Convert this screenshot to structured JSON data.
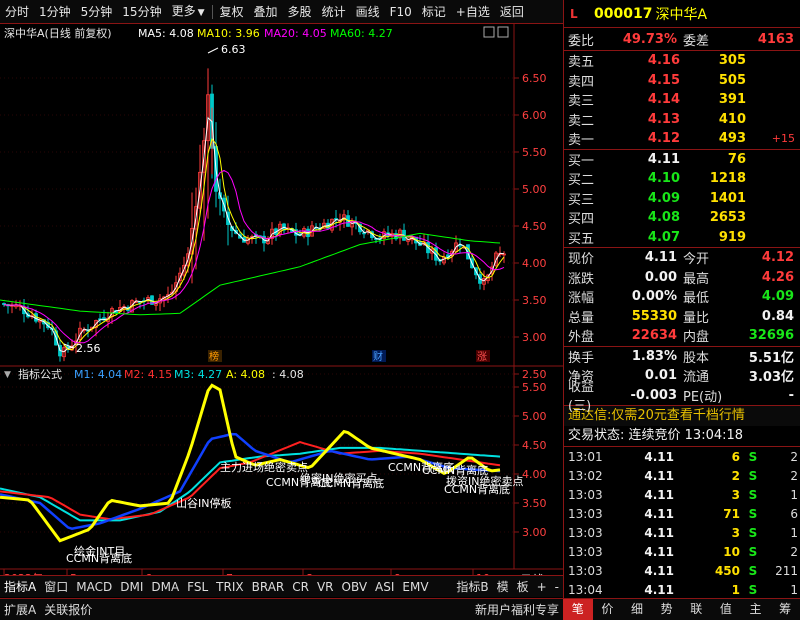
{
  "toolbar": {
    "items": [
      "分时",
      "1分钟",
      "5分钟",
      "15分钟",
      "更多",
      "复权",
      "叠加",
      "多股",
      "统计",
      "画线",
      "F10",
      "标记",
      "+自选",
      "返回"
    ]
  },
  "main_chart": {
    "title": "深中华A(日线 前复权)",
    "ma5": "MA5: 4.08",
    "ma10": "MA10: 3.96",
    "ma20": "MA20: 4.05",
    "ma60": "MA60: 4.27",
    "high_label": "6.63",
    "low_label": "2.56",
    "y_ticks": [
      "6.50",
      "6.00",
      "5.50",
      "5.00",
      "4.50",
      "4.00",
      "3.50",
      "3.00",
      "2.50"
    ],
    "markers": [
      "榜",
      "财",
      "涨"
    ]
  },
  "sub_chart": {
    "title": "指标公式",
    "m1": "M1: 4.04",
    "m2": "M2: 4.15",
    "m3": "M3: 4.27",
    "a": "A: 4.08",
    "extra": ": 4.08",
    "y_ticks": [
      "5.50",
      "5.00",
      "4.50",
      "4.00",
      "3.50",
      "3.00"
    ],
    "annotations": [
      "CCMN背离底",
      "绘金INT目",
      "山谷IN停板",
      "CCMN背离底",
      "主力进场绝密卖点",
      "CCMN背离底",
      "绝密IN绝密买点",
      "CCMN背离底",
      "CCMN背离底",
      "拨资IN绝密卖点",
      "CCMN背离底"
    ]
  },
  "x_axis": {
    "labels": [
      "2022年",
      "5",
      "6",
      "7",
      "8",
      "9",
      "10"
    ],
    "unit": "日线"
  },
  "bottom": {
    "row1": [
      "指标A",
      "窗口",
      "MACD",
      "DMI",
      "DMA",
      "FSL",
      "TRIX",
      "BRAR",
      "CR",
      "VR",
      "OBV",
      "ASI",
      "EMV",
      "指标B",
      "模",
      "板",
      "+",
      "-"
    ],
    "row2": [
      "扩展A",
      "关联报价"
    ],
    "promo": "新用户福利专享",
    "tabs": [
      "笔",
      "价",
      "细",
      "势",
      "联",
      "值",
      "主",
      "筹"
    ]
  },
  "quote": {
    "flag": "L",
    "code": "000017",
    "name": "深中华A",
    "weibi_label": "委比",
    "weibi": "49.73%",
    "weicha_label": "委差",
    "weicha": "4163",
    "asks": [
      {
        "label": "卖五",
        "price": "4.16",
        "vol": "305",
        "chg": ""
      },
      {
        "label": "卖四",
        "price": "4.15",
        "vol": "505",
        "chg": ""
      },
      {
        "label": "卖三",
        "price": "4.14",
        "vol": "391",
        "chg": ""
      },
      {
        "label": "卖二",
        "price": "4.13",
        "vol": "410",
        "chg": ""
      },
      {
        "label": "卖一",
        "price": "4.12",
        "vol": "493",
        "chg": "+15"
      }
    ],
    "bids": [
      {
        "label": "买一",
        "price": "4.11",
        "vol": "76",
        "chg": ""
      },
      {
        "label": "买二",
        "price": "4.10",
        "vol": "1218",
        "chg": ""
      },
      {
        "label": "买三",
        "price": "4.09",
        "vol": "1401",
        "chg": ""
      },
      {
        "label": "买四",
        "price": "4.08",
        "vol": "2653",
        "chg": ""
      },
      {
        "label": "买五",
        "price": "4.07",
        "vol": "919",
        "chg": ""
      }
    ],
    "stats": [
      {
        "a": "现价",
        "b": "4.11",
        "c": "今开",
        "d": "4.12"
      },
      {
        "a": "涨跌",
        "b": "0.00",
        "c": "最高",
        "d": "4.26"
      },
      {
        "a": "涨幅",
        "b": "0.00%",
        "c": "最低",
        "d": "4.09"
      },
      {
        "a": "总量",
        "b": "55330",
        "c": "量比",
        "d": "0.84"
      },
      {
        "a": "外盘",
        "b": "22634",
        "c": "内盘",
        "d": "32696"
      }
    ],
    "stats2": [
      {
        "a": "换手",
        "b": "1.83%",
        "c": "股本",
        "d": "5.51亿"
      },
      {
        "a": "净资",
        "b": "0.01",
        "c": "流通",
        "d": "3.03亿"
      },
      {
        "a": "收益(三)",
        "b": "-0.003",
        "c": "PE(动)",
        "d": "-"
      }
    ],
    "promo": "通达信:仅需20元查看千档行情",
    "status_label": "交易状态: 连续竞价",
    "status_time": "13:04:18",
    "trades": [
      {
        "t": "13:01",
        "p": "4.11",
        "v": "6",
        "d": "S",
        "n": "2"
      },
      {
        "t": "13:02",
        "p": "4.11",
        "v": "2",
        "d": "S",
        "n": "2"
      },
      {
        "t": "13:03",
        "p": "4.11",
        "v": "3",
        "d": "S",
        "n": "1"
      },
      {
        "t": "13:03",
        "p": "4.11",
        "v": "71",
        "d": "S",
        "n": "6"
      },
      {
        "t": "13:03",
        "p": "4.11",
        "v": "3",
        "d": "S",
        "n": "1"
      },
      {
        "t": "13:03",
        "p": "4.11",
        "v": "10",
        "d": "S",
        "n": "2"
      },
      {
        "t": "13:03",
        "p": "4.11",
        "v": "450",
        "d": "S",
        "n": "211"
      },
      {
        "t": "13:04",
        "p": "4.11",
        "v": "1",
        "d": "S",
        "n": "1"
      }
    ]
  },
  "colors": {
    "up": "#ff3b3b",
    "down": "#00c8c8",
    "ma5": "#ffffff",
    "ma10": "#ffff00",
    "ma20": "#ff00ff",
    "ma60": "#00ff00",
    "m1": "#00e0ff",
    "m2": "#ff2020",
    "m3": "#00e0e0",
    "a": "#ffff00"
  },
  "chart_data": {
    "type": "candlestick",
    "y_range": [
      2.5,
      6.63
    ],
    "ohlc_series": "daily",
    "indicators": [
      "MA5",
      "MA10",
      "MA20",
      "MA60"
    ]
  }
}
